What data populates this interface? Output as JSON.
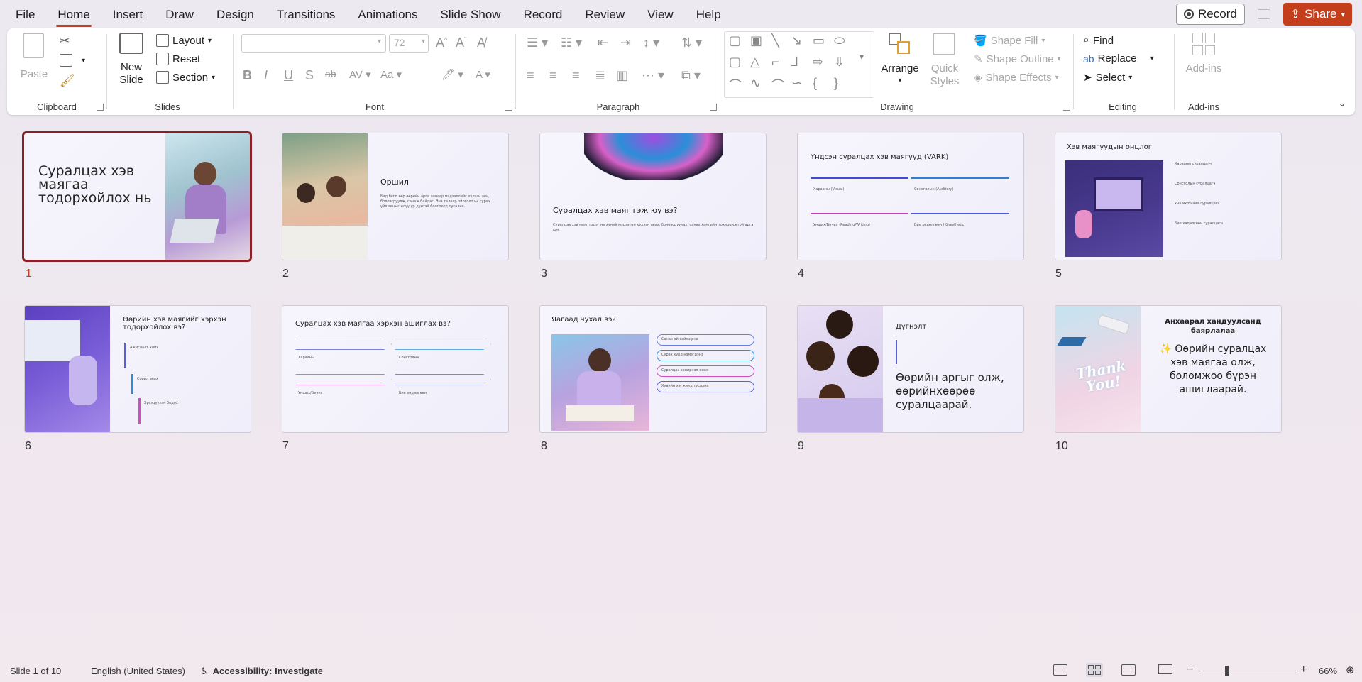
{
  "menu": {
    "tabs": [
      "File",
      "Home",
      "Insert",
      "Draw",
      "Design",
      "Transitions",
      "Animations",
      "Slide Show",
      "Record",
      "Review",
      "View",
      "Help"
    ],
    "record_label": "Record",
    "share_label": "Share"
  },
  "ribbon": {
    "clipboard": {
      "paste": "Paste",
      "label": "Clipboard"
    },
    "slides": {
      "new_slide_1": "New",
      "new_slide_2": "Slide",
      "layout": "Layout",
      "reset": "Reset",
      "section": "Section",
      "label": "Slides"
    },
    "font": {
      "font_size": "72",
      "label": "Font"
    },
    "paragraph": {
      "label": "Paragraph"
    },
    "drawing": {
      "arrange": "Arrange",
      "quick_styles_1": "Quick",
      "quick_styles_2": "Styles",
      "shape_fill": "Shape Fill",
      "shape_outline": "Shape Outline",
      "shape_effects": "Shape Effects",
      "label": "Drawing"
    },
    "editing": {
      "find": "Find",
      "replace": "Replace",
      "select": "Select",
      "label": "Editing"
    },
    "addins": {
      "button": "Add-ins",
      "label": "Add-ins"
    }
  },
  "slides": [
    {
      "num": "1",
      "title": "Суралцах хэв маягаа тодорхойлох нь"
    },
    {
      "num": "2",
      "title": "Оршил",
      "body": "Бид бүгд өөр өөрийн арга замаар мэдээллийг хүлээн авч, боловсруулж, санаж байдаг. Энэ талаар ойлголт нь сурах үйл явцыг илүү үр дүнтэй болгоход тусална."
    },
    {
      "num": "3",
      "title": "Суралцах хэв маяг гэж юу вэ?",
      "body": "Суралцах хэв маяг гэдэг нь хүний мэдээлэл хүлээн авах, боловсруулах, санах хамгийн тохиромжтой арга юм."
    },
    {
      "num": "4",
      "title": "Үндсэн суралцах хэв маягууд (VARK)",
      "items": [
        "Харааны (Visual)",
        "Сонсголын (Auditory)",
        "Унших/Бичих (Reading/Writing)",
        "Бие хөдөлгөөн (Kinesthetic)"
      ]
    },
    {
      "num": "5",
      "title": "Хэв маягуудын онцлог",
      "items": [
        "Харааны суралцагч",
        "Сонсголын суралцагч",
        "Унших/Бичих суралцагч",
        "Бие хөдөлгөөн суралцагч"
      ]
    },
    {
      "num": "6",
      "title": "Өөрийн хэв маягийг хэрхэн тодорхойлох вэ?",
      "items": [
        "Ажиглалт хийх",
        "Сорил авах",
        "Эргэцүүлэн бодох"
      ]
    },
    {
      "num": "7",
      "title": "Суралцах хэв маягаа хэрхэн ашиглах вэ?",
      "items": [
        "Харааны",
        "Сонсголын",
        "Унших/Бичих",
        "Бие хөдөлгөөн"
      ]
    },
    {
      "num": "8",
      "title": "Яагаад чухал вэ?",
      "items": [
        "Санах ой сайжирна",
        "Сурах хурд нэмэгдэнэ",
        "Суралцах сонирхол өсөх",
        "Хувийн хөгжилд тусална"
      ]
    },
    {
      "num": "9",
      "title": "Дүгнэлт",
      "quote": "Өөрийн аргыг олж, өөрийнхөөрөө суралцаарай."
    },
    {
      "num": "10",
      "title": "Анхаарал хандуулсанд баярлалаа",
      "body": "✨ Өөрийн суралцах хэв маягаа олж, боломжоо бүрэн ашиглаарай.",
      "badge": "Thank You!"
    }
  ],
  "status": {
    "slide_info": "Slide 1 of 10",
    "language": "English (United States)",
    "accessibility": "Accessibility: Investigate",
    "zoom": "66%"
  }
}
